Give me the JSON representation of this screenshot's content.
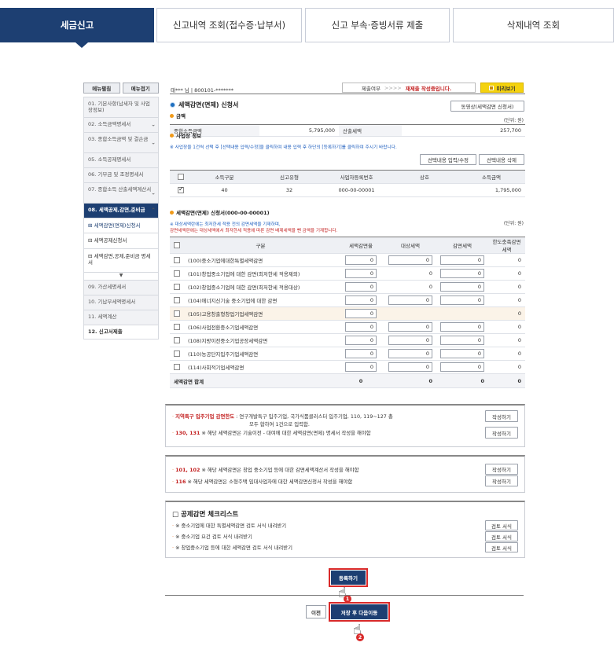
{
  "tabs": [
    "세금신고",
    "신고내역 조회(접수증·납부서)",
    "신고 부속·증빙서류 제출",
    "삭제내역 조회"
  ],
  "sidebar": {
    "expand_label": "메뉴펼침",
    "collapse_label": "메뉴접기",
    "items": [
      "01. 기본사항(납세자 및 사업장정보)",
      "02. 소득금액명세서",
      "03. 종합소득금액 및 결손금",
      "05. 소득공제명세서",
      "06. 기부금 및 조정명세서",
      "07. 종합소득 산출세액계산서",
      "08. 세액공제,감면,준비금",
      "09. 가산세명세서",
      "10. 기납부세액명세서",
      "11. 세액계산",
      "12. 신고서제출"
    ],
    "subitems": [
      "세액감면(면제)신청서",
      "세액공제신청서",
      "세액감면,공제,준비금 명세서"
    ]
  },
  "user_bar": {
    "name": "태*** 님",
    "id": "800101-*******",
    "submit_label": "제출여부",
    "arrows": ">>>>",
    "submit_state": "재제출 작성중입니다.",
    "preview": "미리보기"
  },
  "section_title": "세액감면(면제) 신청서",
  "same_as_button": "동영상(세액감면 신청서)",
  "amount": {
    "title": "금액",
    "unit": "(단위: 원)",
    "total_income_label": "종합소득금액",
    "total_income": "5,795,000",
    "calc_tax_label": "산출세액",
    "calc_tax": "257,700"
  },
  "business": {
    "title": "사업장 정보",
    "note": "※ 사업장을 1건씩 선택 후 [선택내용 입력/수정]을 클릭하여 내용 입력 후 하단의 [등록하기]를 클릭하여 주시기 바랍니다.",
    "edit_button": "선택내용 입력/수정",
    "delete_button": "선택내용 삭제",
    "headers": [
      "소득구분",
      "신고유형",
      "사업자등록번호",
      "상호",
      "소득금액"
    ],
    "rows": [
      {
        "income_type": "40",
        "report_type": "32",
        "biz_no": "000-00-00001",
        "name": "",
        "amount": "1,795,000"
      }
    ]
  },
  "reduction": {
    "title": "세액감면(면제) 신청서(000-00-00001)",
    "note1": "※ 대상세액란에는 최저한세 적용 전의 감면세액을 기재하며,",
    "note2": "감면세액란에는 대상세액에서 최저한세 적용에 따른 감면 배제세액을 뺀 금액을 기재합니다.",
    "unit": "(단위: 원)",
    "headers": [
      "구분",
      "세액감면율",
      "대상세액",
      "감면세액",
      "한도충족감면세액"
    ],
    "rows": [
      {
        "label": "(100)중소기업에대한특별세액감면",
        "rate": "0",
        "target": "0",
        "reduced": "0",
        "limit": "0",
        "target_input": true
      },
      {
        "label": "(101)창업중소기업에 대한 감면(최저한세 적용제외)",
        "rate": "0",
        "target": "0",
        "reduced": "0",
        "limit": "0",
        "target_input": false
      },
      {
        "label": "(102)창업중소기업에 대한 감면(최저한세 적용대상)",
        "rate": "0",
        "target": "0",
        "reduced": "0",
        "limit": "0",
        "target_input": false
      },
      {
        "label": "(104)에너지신기술 중소기업에 대한 감면",
        "rate": "0",
        "target": "0",
        "reduced": "0",
        "limit": "0",
        "target_input": true
      },
      {
        "label": "(105)고용창출형창업기업세액감면",
        "rate": "0",
        "target": "",
        "reduced": "",
        "limit": "0",
        "target_input": false
      },
      {
        "label": "(106)사업전환중소기업세액감면",
        "rate": "0",
        "target": "0",
        "reduced": "0",
        "limit": "0",
        "target_input": true
      },
      {
        "label": "(108)지방이전중소기업공장세액감면",
        "rate": "0",
        "target": "0",
        "reduced": "0",
        "limit": "0",
        "target_input": true
      },
      {
        "label": "(110)농공단지입주기업세액감면",
        "rate": "0",
        "target": "0",
        "reduced": "0",
        "limit": "0",
        "target_input": true
      },
      {
        "label": "(114)사회적기업세액감면",
        "rate": "0",
        "target": "0",
        "reduced": "0",
        "limit": "0",
        "target_input": true
      }
    ],
    "total_label": "세액감면 합계",
    "total": {
      "rate": "0",
      "target": "0",
      "reduced": "0",
      "limit": "0"
    }
  },
  "box1": {
    "line1_red": "지역특구 입주기업 감면한도",
    "line1_rest": " : 연구개발특구 입주기업, 국가식품클러스터 입주기업, 110, 119~127 총",
    "line1_cont": "모두 합하여 1건으로 입력함.",
    "line2_red": "130, 131",
    "line2_rest": " ※ 해당 세액감면은 기술이전 - 대여에 대한 세액감면(면제) 명세서 작성을 해야함",
    "button": "작성하기"
  },
  "box2": {
    "line1_red": "101, 102",
    "line1_rest": " ※ 해당 세액감면은 창업 중소기업 등에 대한 감면세액계산서 작성을 해야함",
    "line2_red": "116",
    "line2_rest": " ※ 해당 세액감면은 소형주택 임대사업자에 대한 세액감면신청서 작성을 해야함",
    "button": "작성하기"
  },
  "checklist": {
    "title": "□ 공제감면 체크리스트",
    "lines": [
      "※ 중소기업에 대한 특별세액감면 검토 서식 내려받기",
      "※ 중소기업 요건 검토 서식 내려받기",
      "※ 창업중소기업 등에 대한 세액감면 검토 서식 내려받기"
    ],
    "button": "검토 서식"
  },
  "actions": {
    "register": "등록하기",
    "prev": "이전",
    "save_next": "저장 후 다음이동",
    "step1": "1",
    "step2": "2"
  },
  "colors": {
    "navy": "#1d3f72",
    "accent_red": "#d92a2a",
    "preview_yellow": "#f4d20e",
    "dot_orange": "#f09a1a",
    "dot_blue": "#1f6fbf"
  }
}
